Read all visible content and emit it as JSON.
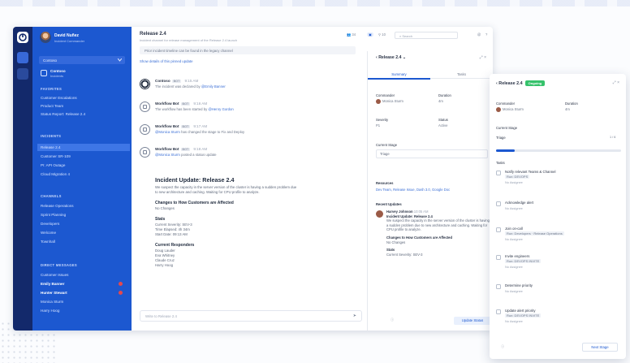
{
  "sidebar": {
    "user_name": "David Nuñez",
    "user_status": "Incident Commander",
    "team_select": "Contoso",
    "channel_name": "Contoso",
    "channel_sub": "Incidents",
    "sections": {
      "favorites": "FAVORITES",
      "incidents": "INCIDENTS",
      "channels": "CHANNELS",
      "dms": "DIRECT MESSAGES"
    },
    "favorites": [
      "Customer Escalations",
      "Product Team",
      "Status Report: Release 2.4"
    ],
    "incidents": [
      "Release 2.4",
      "Customer SR-109",
      "PI: API Outage",
      "Cloud Migration 4"
    ],
    "channels": [
      "Release Operations",
      "Sprint Planning",
      "Developers",
      "Welcome",
      "Townhall"
    ],
    "dms": [
      "Customer Issues",
      "Emily Banner",
      "Hunter Stewart",
      "Monica Sturm",
      "Harry Hoog"
    ]
  },
  "chat": {
    "title": "Release 2.4",
    "subtitle": "Incident channel for release management of the Release 2.4 launch",
    "toolbar_count": "34",
    "toolbar_members": "10",
    "search_placeholder": "Search",
    "banner": "Prior incident timeline can be found in the legacy channel",
    "pinned": "Show details of this pinned update",
    "posts": [
      {
        "author": "Contoso",
        "tag": "BOT",
        "time": "9:15 AM",
        "text": "The incident was declared by ",
        "link": "@Emily Banner"
      },
      {
        "author": "Workflow Bot",
        "tag": "BOT",
        "time": "9:16 AM",
        "text": "The workflow has been started by ",
        "link": "@Henry Gordon"
      },
      {
        "author": "Workflow Bot",
        "tag": "BOT",
        "time": "9:17 AM",
        "text": "",
        "link": "@Monica Sturm",
        "after": " has changed the stage to Fix and Deploy"
      },
      {
        "author": "Workflow Bot",
        "tag": "BOT",
        "time": "9:18 AM",
        "text": "",
        "link": "@Monica Sturm",
        "after": " posted a status update"
      }
    ],
    "incident": {
      "title": "Incident Update: Release 2.4",
      "lead": "We suspect the capacity in the server version of the cluster is having a sudden problem due",
      "lead2": "to new architecture and caching. Waiting for CPU profile to analyze.",
      "h_changes": "Changes to How Customers are Affected",
      "changes": "No Changes",
      "h_stats": "Stats",
      "stats": [
        "Current Severity: SEV-3",
        "Time Elapsed: 4h 34m",
        "Start Date: 09:13 AM"
      ],
      "h_resp": "Current Responders",
      "responders": [
        "Doug Lauder",
        "Eva Whitney",
        "Claude Cruz",
        "Harry Hoog"
      ]
    },
    "composer_placeholder": "Write to Release 2.4"
  },
  "rhs": {
    "title": "Release 2.4",
    "tab_summary": "Summary",
    "tab_tasks": "Tasks",
    "commander_label": "Commander",
    "commander": "Monica Sturm",
    "duration_label": "Duration",
    "duration": "4m",
    "severity_label": "Severity",
    "severity": "P1",
    "status_label": "Status",
    "status": "Active",
    "stage_label": "Current Stage",
    "stage": "Triage",
    "resources_label": "Resources",
    "resources": "Dev Team, Release Issue, Dash 3.0, Google Doc",
    "updates_label": "Recent Updates",
    "update_author": "Harvey Johnson",
    "update_time": "10:05 AM",
    "update_title": "Incident Update: Release 2.4",
    "update_text": "We suspect the capacity in the server version of the cluster is having a sudden problem due to new architecture and caching. Waiting for CPU profile to analyze.",
    "update_h_changes": "Changes to How Customers are Affected",
    "update_changes": "No Changes",
    "update_h_stats": "Stats",
    "update_stats": "Current Severity: SEV-3",
    "update_button": "Update Status"
  },
  "floating": {
    "title": "Release 2.4",
    "pill": "Ongoing",
    "commander_label": "Commander",
    "commander": "Monica Sturm",
    "duration_label": "Duration",
    "duration": "4m",
    "stage_label": "Current Stage",
    "stage": "Triage",
    "stage_count": "1 / 6",
    "tasks_label": "Tasks",
    "progress": 0.15,
    "tasks": [
      {
        "title": "Notify relevant Teams & Channel",
        "tag": "Run: DEVOPS",
        "assignee": "No Assignee"
      },
      {
        "title": "Acknowledge alert",
        "tag": "",
        "assignee": "No Assignee"
      },
      {
        "title": "Join on-call",
        "tag": "Run: Developers · Release Operations",
        "assignee": "No Assignee"
      },
      {
        "title": "Invite engineers",
        "tag": "Run: DEVOPS INVITE",
        "assignee": "No Assignee"
      },
      {
        "title": "Determine priority",
        "tag": "",
        "assignee": "No Assignee"
      },
      {
        "title": "Update alert priority",
        "tag": "Run: DEVOPS INVITE",
        "assignee": "No Assignee"
      }
    ],
    "finish_button": "Next Stage"
  }
}
